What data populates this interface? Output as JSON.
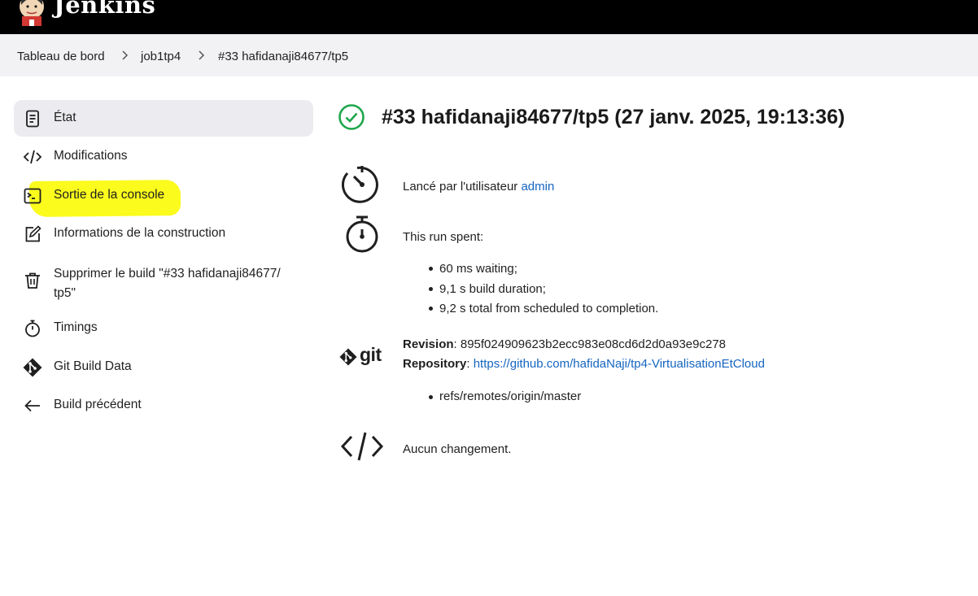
{
  "header": {
    "brand": "Jenkins"
  },
  "breadcrumb": {
    "items": [
      "Tableau de bord",
      "job1tp4",
      "#33 hafidanaji84677/tp5"
    ]
  },
  "sidebar": {
    "items": [
      {
        "label": "État",
        "icon": "document-icon",
        "active": true
      },
      {
        "label": "Modifications",
        "icon": "code-icon"
      },
      {
        "label": "Sortie de la console",
        "icon": "terminal-icon"
      },
      {
        "label": "Informations de la construction",
        "icon": "edit-icon"
      },
      {
        "label_line1": "Supprimer le build \"#33 hafidanaji84677/",
        "label_line2": "tp5\"",
        "icon": "trash-icon"
      },
      {
        "label": "Timings",
        "icon": "stopwatch-icon"
      },
      {
        "label": "Git Build Data",
        "icon": "git-icon"
      },
      {
        "label": "Build précédent",
        "icon": "arrow-left-icon"
      }
    ]
  },
  "main": {
    "title": "#33 hafidanaji84677/tp5 (27 janv. 2025, 19:13:36)",
    "status_color": "#1ea64b",
    "started_by_prefix": "Lancé par l'utilisateur ",
    "started_by_user": "admin",
    "run_spent_label": "This run spent:",
    "run_spent_items": [
      "60 ms waiting;",
      "9,1 s build duration;",
      "9,2 s total from scheduled to completion."
    ],
    "git_logo_text": "git",
    "revision_label": "Revision",
    "revision_value": ": 895f024909623b2ecc983e08cd6d2d0a93e9c278",
    "repository_label": "Repository",
    "repository_sep": ": ",
    "repository_url": "https://github.com/hafidaNaji/tp4-VirtualisationEtCloud",
    "refs_item": "refs/remotes/origin/master",
    "changes_text": "Aucun changement."
  },
  "colors": {
    "link": "#1565c0",
    "highlight": "#fbfb1d",
    "header_bg": "#000000"
  }
}
